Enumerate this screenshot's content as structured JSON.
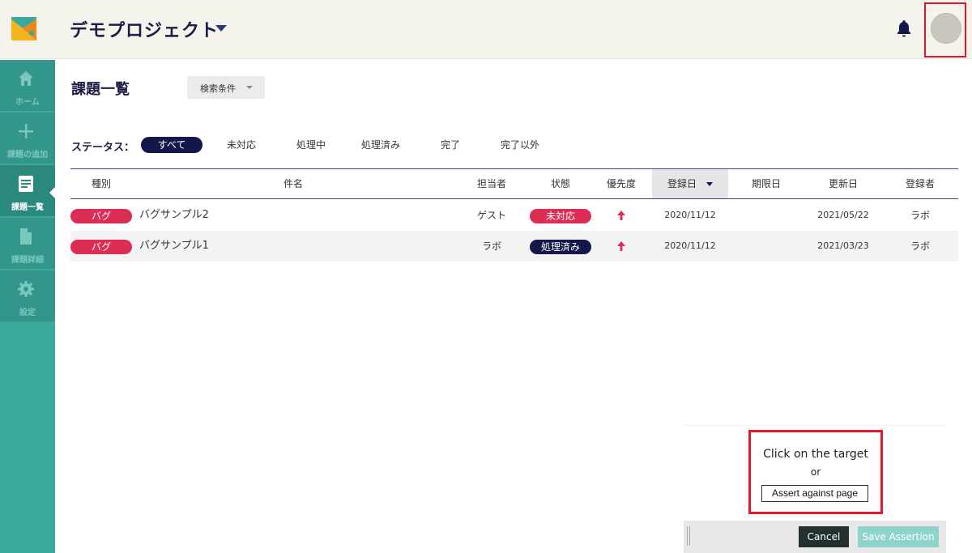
{
  "header": {
    "project_title": "デモプロジェクト"
  },
  "sidebar": {
    "items": [
      {
        "label": "ホーム",
        "icon": "home-icon"
      },
      {
        "label": "課題の追加",
        "icon": "plus-icon"
      },
      {
        "label": "課題一覧",
        "icon": "list-icon"
      },
      {
        "label": "課題詳細",
        "icon": "document-icon"
      },
      {
        "label": "設定",
        "icon": "gear-icon"
      }
    ]
  },
  "main": {
    "title": "課題一覧",
    "filter_label": "検索条件",
    "status_label": "ステータス：",
    "status_options": [
      "すべて",
      "未対応",
      "処理中",
      "処理済み",
      "完了",
      "完了以外"
    ],
    "columns": [
      "種別",
      "件名",
      "担当者",
      "状態",
      "優先度",
      "登録日",
      "期限日",
      "更新日",
      "登録者"
    ],
    "rows": [
      {
        "type": "バグ",
        "subject": "バグサンプル2",
        "assignee": "ゲスト",
        "state": "未対応",
        "priority": "high",
        "created": "2020/11/12",
        "due": "",
        "updated": "2021/05/22",
        "creator": "ラボ"
      },
      {
        "type": "バグ",
        "subject": "バグサンプル1",
        "assignee": "ラボ",
        "state": "処理済み",
        "priority": "high",
        "created": "2020/11/12",
        "due": "",
        "updated": "2021/03/23",
        "creator": "ラボ"
      }
    ]
  },
  "assertion": {
    "prompt": "Click on the target",
    "or": "or",
    "assert_button": "Assert against page",
    "cancel": "Cancel",
    "save": "Save Assertion"
  },
  "colors": {
    "brand_navy": "#13174a",
    "sidebar_teal": "#3aa89a",
    "badge_red": "#dc2d55",
    "highlight_red": "#e0182a"
  }
}
